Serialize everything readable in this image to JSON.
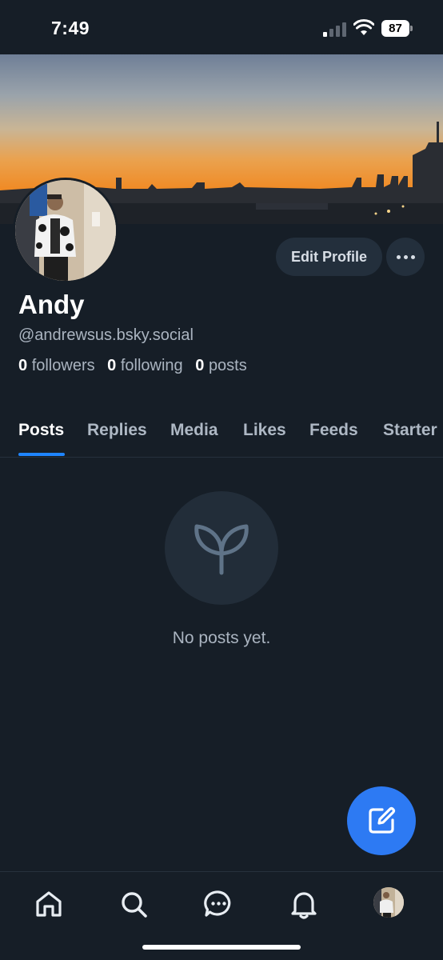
{
  "status_bar": {
    "time": "7:49",
    "battery_level": "87",
    "signal_bars_active": 1,
    "signal_bars_total": 4
  },
  "profile": {
    "display_name": "Andy",
    "handle": "@andrewsus.bsky.social",
    "followers_count": "0",
    "followers_label": "followers",
    "following_count": "0",
    "following_label": "following",
    "posts_count": "0",
    "posts_label": "posts"
  },
  "actions": {
    "edit_profile_label": "Edit Profile",
    "more_icon": "more-horizontal-icon"
  },
  "tabs": [
    {
      "label": "Posts",
      "active": true
    },
    {
      "label": "Replies",
      "active": false
    },
    {
      "label": "Media",
      "active": false
    },
    {
      "label": "Likes",
      "active": false
    },
    {
      "label": "Feeds",
      "active": false
    },
    {
      "label": "Starter",
      "active": false
    }
  ],
  "empty_state": {
    "icon": "sprout-icon",
    "message": "No posts yet."
  },
  "compose_button": {
    "icon": "compose-icon"
  },
  "bottom_nav": [
    {
      "icon": "home-icon"
    },
    {
      "icon": "search-icon"
    },
    {
      "icon": "chat-icon"
    },
    {
      "icon": "bell-icon"
    },
    {
      "icon": "profile-avatar"
    }
  ],
  "colors": {
    "background": "#161e27",
    "accent": "#1f85ff",
    "fab": "#2d7af3",
    "muted_text": "#aab4c0"
  }
}
